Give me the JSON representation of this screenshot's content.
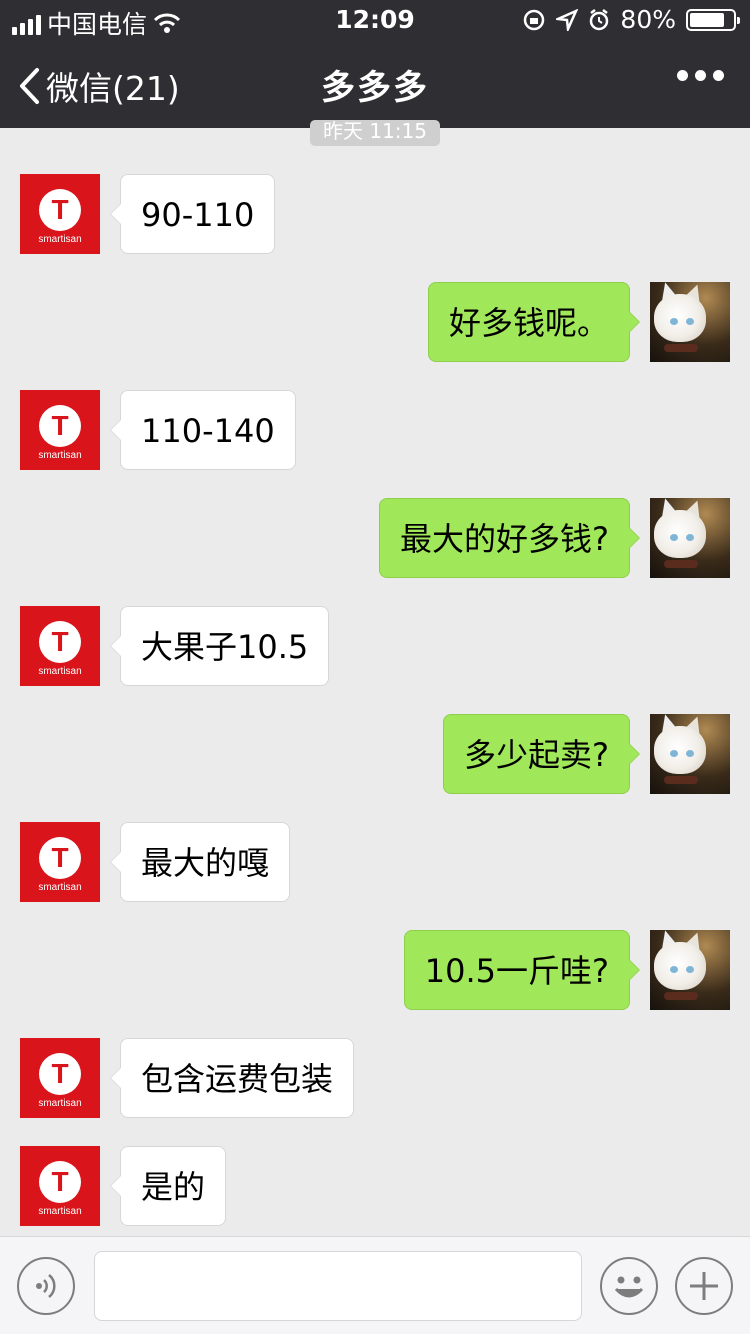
{
  "status_bar": {
    "carrier": "中国电信",
    "time": "12:09",
    "battery_percent": "80%",
    "battery_level": 0.8,
    "icons": [
      "signal-icon",
      "wifi-icon",
      "rotation-lock-icon",
      "location-icon",
      "alarm-icon",
      "battery-icon"
    ]
  },
  "nav": {
    "back_label": "微信(21)",
    "title": "多多多",
    "more_icon": "more-dots-icon"
  },
  "timestamp": "昨天 11:15",
  "contact_avatar": {
    "letter": "T",
    "brand": "smartisan",
    "color": "#d9141a"
  },
  "me_avatar": {
    "description_icon": "cat-avatar-icon"
  },
  "messages": [
    {
      "side": "in",
      "text": "90-110"
    },
    {
      "side": "out",
      "text": "好多钱呢。"
    },
    {
      "side": "in",
      "text": "110-140"
    },
    {
      "side": "out",
      "text": "最大的好多钱?"
    },
    {
      "side": "in",
      "text": "大果子10.5"
    },
    {
      "side": "out",
      "text": "多少起卖?"
    },
    {
      "side": "in",
      "text": "最大的嘎"
    },
    {
      "side": "out",
      "text": "10.5一斤哇?"
    },
    {
      "side": "in",
      "text": "包含运费包装"
    },
    {
      "side": "in",
      "text": "是的"
    }
  ],
  "input_bar": {
    "voice_icon": "voice-icon",
    "input_value": "",
    "emoji_icon": "emoji-icon",
    "plus_icon": "plus-icon"
  },
  "colors": {
    "nav_bg": "#2f2f33",
    "chat_bg": "#ebebeb",
    "out_bubble": "#a0e75a",
    "in_bubble": "#ffffff"
  }
}
